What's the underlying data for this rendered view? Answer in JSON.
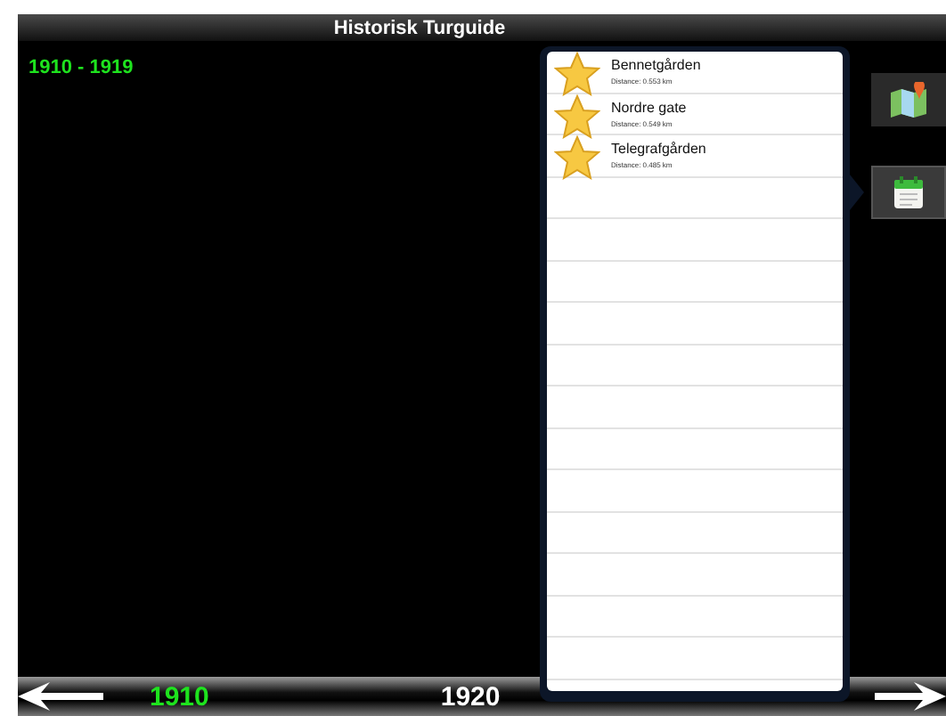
{
  "header": {
    "title": "Historisk Turguide"
  },
  "period": "1910 - 1919",
  "places": [
    {
      "name": "Bennetgården",
      "distance": "Distance: 0.553 km"
    },
    {
      "name": "Nordre gate",
      "distance": "Distance: 0.549 km"
    },
    {
      "name": "Telegrafgården",
      "distance": "Distance: 0.485 km"
    }
  ],
  "side_buttons": [
    {
      "kind": "map",
      "selected": false
    },
    {
      "kind": "calendar",
      "selected": true
    }
  ],
  "timeline": [
    {
      "label": "1910",
      "selected": true
    },
    {
      "label": "1920",
      "selected": false
    }
  ]
}
